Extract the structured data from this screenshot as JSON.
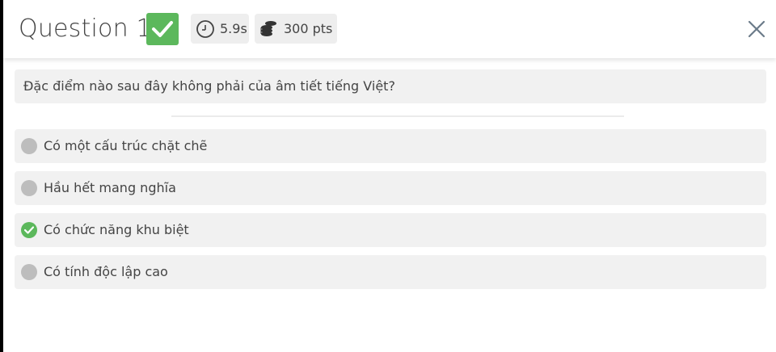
{
  "header": {
    "title": "Question 1",
    "status_icon": "check-icon",
    "time": "5.9s",
    "time_icon": "clock-icon",
    "points": "300 pts",
    "points_icon": "coins-icon",
    "close_icon": "close-icon"
  },
  "question": {
    "text": "Đặc điểm nào sau đây không phải của âm tiết tiếng Việt?"
  },
  "options": [
    {
      "label": "Có một cấu trúc chặt chẽ",
      "state": "neutral"
    },
    {
      "label": "Hầu hết mang nghĩa",
      "state": "neutral"
    },
    {
      "label": "Có chức năng khu biệt",
      "state": "correct"
    },
    {
      "label": "Có tính độc lập cao",
      "state": "neutral"
    }
  ],
  "colors": {
    "correct": "#5cb85c",
    "neutral_radio": "#bdbdbd",
    "option_bg": "#f1f1f1",
    "text": "#444444"
  }
}
